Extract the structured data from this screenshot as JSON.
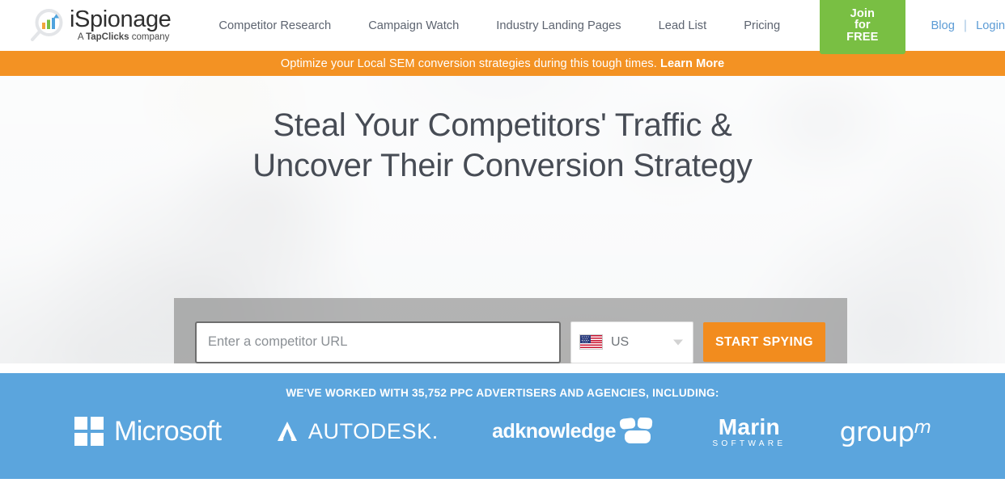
{
  "brand": {
    "name": "iSpionage",
    "tagline_prefix": "A ",
    "tagline_strong": "TapClicks",
    "tagline_suffix": " company",
    "logo_icon": "magnifier-barchart-icon"
  },
  "nav": {
    "items": [
      {
        "label": "Competitor Research"
      },
      {
        "label": "Campaign Watch"
      },
      {
        "label": "Industry Landing Pages"
      },
      {
        "label": "Lead List"
      },
      {
        "label": "Pricing"
      }
    ],
    "join_label": "Join for FREE",
    "blog_label": "Blog",
    "login_label": "Login",
    "separator": "|"
  },
  "banner": {
    "text": "Optimize your Local SEM conversion strategies during this tough times. ",
    "link_label": "Learn More"
  },
  "hero": {
    "headline_line1": "Steal Your Competitors' Traffic &",
    "headline_line2": "Uncover Their Conversion Strategy"
  },
  "search_form": {
    "url_placeholder": "Enter a competitor URL",
    "url_value": "",
    "country_label": "US",
    "country_flag_icon": "us-flag-icon",
    "dropdown_icon": "chevron-down-icon",
    "submit_label": "START SPYING"
  },
  "clients": {
    "title": "WE'VE WORKED WITH 35,752 PPC ADVERTISERS AND AGENCIES, INCLUDING:",
    "logos": [
      {
        "name": "Microsoft",
        "icon": "microsoft-logo"
      },
      {
        "name": "AUTODESK.",
        "icon": "autodesk-logo"
      },
      {
        "name": "adknowledge",
        "icon": "adknowledge-logo"
      },
      {
        "name": "Marin",
        "sub": "SOFTWARE",
        "icon": "marin-software-logo"
      },
      {
        "name": "group",
        "sup": "m",
        "icon": "groupm-logo"
      }
    ]
  },
  "colors": {
    "brand_green": "#79bf43",
    "banner_orange": "#f39223",
    "cta_orange": "#f28c1e",
    "clients_blue": "#5ba5dd",
    "link_blue": "#5b9bd5",
    "heading_gray": "#474c55"
  }
}
